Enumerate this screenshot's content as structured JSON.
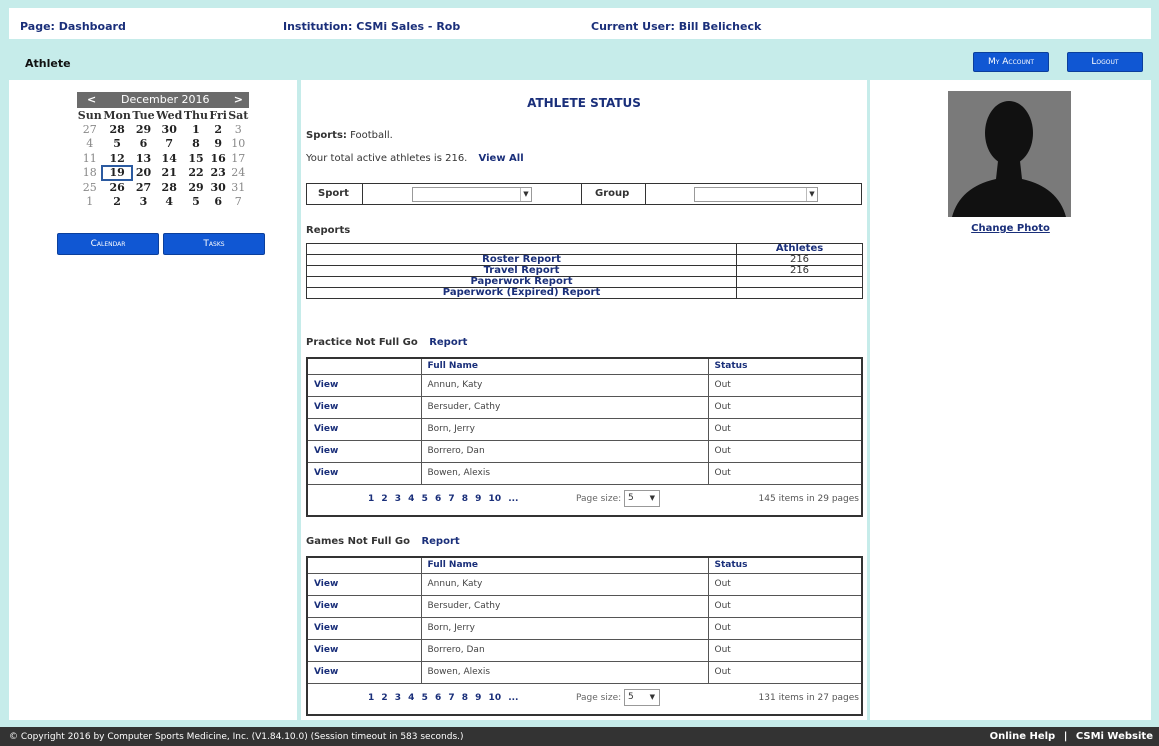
{
  "header": {
    "page": "Page: Dashboard",
    "institution": "Institution: CSMi Sales - Rob",
    "current_user": "Current User: Bill Belicheck"
  },
  "subbar": {
    "title": "Athlete",
    "my_account": "My Account",
    "logout": "Logout"
  },
  "calendar": {
    "prev": "<",
    "next": ">",
    "month": "December 2016",
    "days_of_week": [
      "Sun",
      "Mon",
      "Tue",
      "Wed",
      "Thu",
      "Fri",
      "Sat"
    ],
    "weeks": [
      [
        "27",
        "28",
        "29",
        "30",
        "1",
        "2",
        "3"
      ],
      [
        "4",
        "5",
        "6",
        "7",
        "8",
        "9",
        "10"
      ],
      [
        "11",
        "12",
        "13",
        "14",
        "15",
        "16",
        "17"
      ],
      [
        "18",
        "19",
        "20",
        "21",
        "22",
        "23",
        "24"
      ],
      [
        "25",
        "26",
        "27",
        "28",
        "29",
        "30",
        "31"
      ],
      [
        "1",
        "2",
        "3",
        "4",
        "5",
        "6",
        "7"
      ]
    ],
    "today": "19",
    "calendar_button": "Calendar",
    "tasks_button": "Tasks"
  },
  "status": {
    "heading": "ATHLETE STATUS",
    "sports_label": "Sports:",
    "sports_value": "Football.",
    "active_text": "Your total active athletes is 216.",
    "view_all": "View All",
    "sport_label": "Sport",
    "group_label": "Group",
    "reports_label": "Reports",
    "athletes_header": "Athletes",
    "reports": [
      {
        "name": "Roster Report",
        "count": "216"
      },
      {
        "name": "Travel Report",
        "count": "216"
      },
      {
        "name": "Paperwork Report",
        "count": ""
      },
      {
        "name": "Paperwork (Expired) Report",
        "count": ""
      }
    ]
  },
  "practice": {
    "title": "Practice Not Full Go",
    "report_link": "Report",
    "col_fullname": "Full Name",
    "col_status": "Status",
    "rows": [
      {
        "view": "View",
        "name": "Annun, Katy",
        "status": "Out"
      },
      {
        "view": "View",
        "name": "Bersuder, Cathy",
        "status": "Out"
      },
      {
        "view": "View",
        "name": "Born, Jerry",
        "status": "Out"
      },
      {
        "view": "View",
        "name": "Borrero, Dan",
        "status": "Out"
      },
      {
        "view": "View",
        "name": "Bowen, Alexis",
        "status": "Out"
      }
    ],
    "pages": "1 2 3 4 5 6 7 8 9 10 ...",
    "page_size_label": "Page size:",
    "page_size": "5",
    "items_info": "145 items in 29 pages"
  },
  "games": {
    "title": "Games Not Full Go",
    "report_link": "Report",
    "col_fullname": "Full Name",
    "col_status": "Status",
    "rows": [
      {
        "view": "View",
        "name": "Annun, Katy",
        "status": "Out"
      },
      {
        "view": "View",
        "name": "Bersuder, Cathy",
        "status": "Out"
      },
      {
        "view": "View",
        "name": "Born, Jerry",
        "status": "Out"
      },
      {
        "view": "View",
        "name": "Borrero, Dan",
        "status": "Out"
      },
      {
        "view": "View",
        "name": "Bowen, Alexis",
        "status": "Out"
      }
    ],
    "pages": "1 2 3 4 5 6 7 8 9 10 ...",
    "page_size_label": "Page size:",
    "page_size": "5",
    "items_info": "131 items in 27 pages"
  },
  "profile": {
    "change_photo": "Change Photo"
  },
  "footer": {
    "copyright": "© Copyright 2016 by Computer Sports Medicine, Inc. (V1.84.10.0) (Session timeout in 583 seconds.)",
    "online_help": "Online Help",
    "separator": "|",
    "csmi_website": "CSMi Website"
  }
}
